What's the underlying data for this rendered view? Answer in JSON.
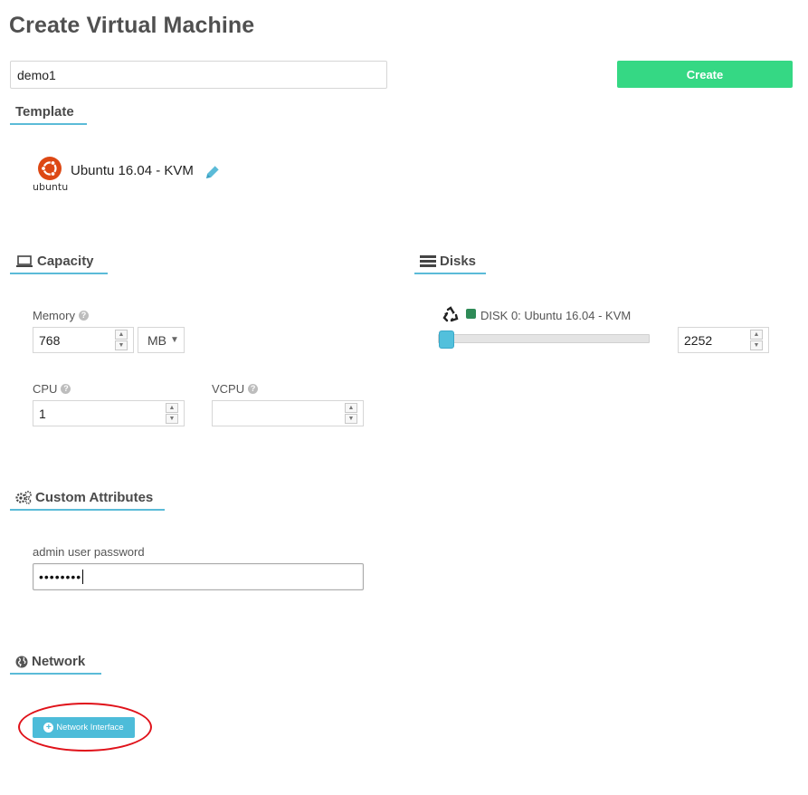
{
  "page": {
    "title": "Create Virtual Machine"
  },
  "vm": {
    "name_value": "demo1"
  },
  "actions": {
    "create_label": "Create"
  },
  "template": {
    "header": "Template",
    "name": "Ubuntu 16.04 - KVM",
    "logo_text": "ubuntu",
    "logo_color": "#dd4814"
  },
  "capacity": {
    "header": "Capacity",
    "memory_label": "Memory",
    "memory_value": "768",
    "memory_unit": "MB",
    "cpu_label": "CPU",
    "cpu_value": "1",
    "vcpu_label": "VCPU",
    "vcpu_value": ""
  },
  "disks": {
    "header": "Disks",
    "items": [
      {
        "label": "DISK 0: Ubuntu 16.04 - KVM",
        "size_value": "2252",
        "slider_fraction": 0.0,
        "status_color": "#2e8b57"
      }
    ]
  },
  "custom_attributes": {
    "header": "Custom Attributes",
    "password_label": "admin user password",
    "password_mask": "••••••••"
  },
  "network": {
    "header": "Network",
    "add_interface_label": "Network Interface"
  },
  "colors": {
    "accent": "#5bbbd8",
    "create_button": "#35d884",
    "annotation": "#e0121a"
  }
}
